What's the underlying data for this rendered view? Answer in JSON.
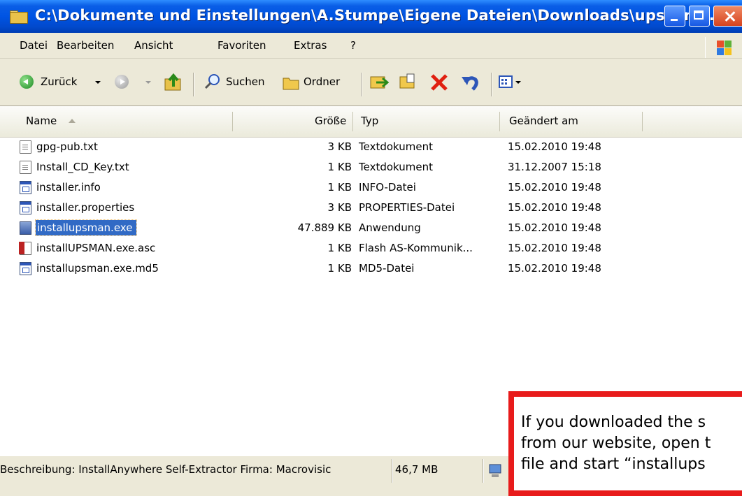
{
  "window": {
    "title": "C:\\Dokumente und Einstellungen\\A.Stumpe\\Eigene Dateien\\Downloads\\upswinc..."
  },
  "menu": [
    "Datei",
    "Bearbeiten",
    "Ansicht",
    "Favoriten",
    "Extras",
    "?"
  ],
  "toolbar": {
    "back_label": "Zurück",
    "search_label": "Suchen",
    "folders_label": "Ordner"
  },
  "columns": {
    "name": "Name",
    "size": "Größe",
    "type": "Typ",
    "modified": "Geändert am"
  },
  "files": [
    {
      "name": "gpg-pub.txt",
      "size": "3 KB",
      "type": "Textdokument",
      "modified": "15.02.2010 19:48",
      "icon": "text-file-icon"
    },
    {
      "name": "Install_CD_Key.txt",
      "size": "1 KB",
      "type": "Textdokument",
      "modified": "31.12.2007 15:18",
      "icon": "text-file-icon"
    },
    {
      "name": "installer.info",
      "size": "1 KB",
      "type": "INFO-Datei",
      "modified": "15.02.2010 19:48",
      "icon": "generic-file-icon"
    },
    {
      "name": "installer.properties",
      "size": "3 KB",
      "type": "PROPERTIES-Datei",
      "modified": "15.02.2010 19:48",
      "icon": "generic-file-icon"
    },
    {
      "name": "installupsman.exe",
      "size": "47.889 KB",
      "type": "Anwendung",
      "modified": "15.02.2010 19:48",
      "icon": "application-icon",
      "selected": true
    },
    {
      "name": "installUPSMAN.exe.asc",
      "size": "1 KB",
      "type": "Flash AS-Kommunik...",
      "modified": "15.02.2010 19:48",
      "icon": "flash-file-icon"
    },
    {
      "name": "installupsman.exe.md5",
      "size": "1 KB",
      "type": "MD5-Datei",
      "modified": "15.02.2010 19:48",
      "icon": "generic-file-icon"
    }
  ],
  "status": {
    "description": "Beschreibung: InstallAnywhere Self-Extractor Firma: Macrovisic",
    "size": "46,7 MB"
  },
  "annotation": {
    "lines": [
      "If you downloaded the s",
      "from our website, open t",
      "file and start “installups"
    ]
  },
  "colors": {
    "titlebar": "#0054e3",
    "selection": "#316ac5",
    "annotation_border": "#e81b1b"
  }
}
